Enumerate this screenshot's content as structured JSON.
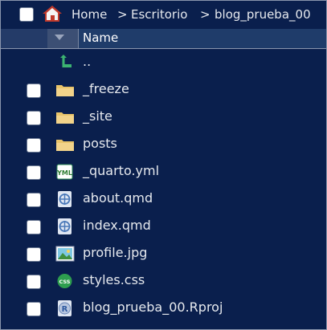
{
  "breadcrumb": {
    "home": "Home",
    "folder1": "Escritorio",
    "folder2": "blog_prueba_00",
    "separator": ">"
  },
  "columns": {
    "name": "Name"
  },
  "files": [
    {
      "name": "..",
      "icon": "parent-folder-icon"
    },
    {
      "name": "_freeze",
      "icon": "folder-icon"
    },
    {
      "name": "_site",
      "icon": "folder-icon"
    },
    {
      "name": "posts",
      "icon": "folder-icon"
    },
    {
      "name": "_quarto.yml",
      "icon": "yml-file-icon",
      "icon_text": "YML"
    },
    {
      "name": "about.qmd",
      "icon": "qmd-file-icon"
    },
    {
      "name": "index.qmd",
      "icon": "qmd-file-icon"
    },
    {
      "name": "profile.jpg",
      "icon": "image-file-icon"
    },
    {
      "name": "styles.css",
      "icon": "css-file-icon",
      "icon_text": "CSS"
    },
    {
      "name": "blog_prueba_00.Rproj",
      "icon": "rproj-file-icon",
      "icon_text": "R"
    }
  ],
  "colors": {
    "background": "#0a1f4d",
    "header": "#1f3c6a",
    "text": "#e6e9ee",
    "folder": "#e9c46a",
    "parent_arrow": "#3cb371",
    "home_roof": "#c0392b"
  }
}
